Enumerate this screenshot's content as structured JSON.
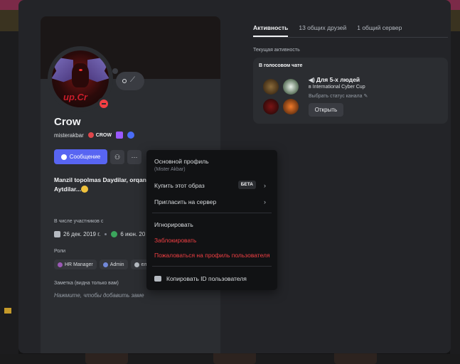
{
  "profile": {
    "display_name": "Crow",
    "username": "misterakbar",
    "avatar_text": "up.Cr",
    "clan_tag": "CROW",
    "bio": "Manzil topolmas Daydilar, orqang",
    "bio_line2": "Aytdilar...",
    "member_since_label": "В числе участников с",
    "discord_since": "26 дек. 2019 г.",
    "server_since": "6 июн. 20",
    "roles_label": "Роли",
    "roles": [
      {
        "name": "HR Manager",
        "color": "#9b59b6"
      },
      {
        "name": "Admin",
        "color": "#7289da"
      },
      {
        "name": "ел",
        "color": "#b5bac1"
      }
    ],
    "note_label": "Заметка (видна только вам)",
    "note_placeholder": "Нажмите, чтобы добавить заме"
  },
  "actions": {
    "message_label": "Сообщение",
    "more_label": "···",
    "friend_icon": "add-friend-icon"
  },
  "tabs": [
    {
      "label": "Активность",
      "active": true
    },
    {
      "label": "13 общих друзей",
      "active": false
    },
    {
      "label": "1 общий сервер",
      "active": false
    }
  ],
  "activity": {
    "section_label": "Текущая активность",
    "card_title": "В голосовом чате",
    "channel_name": "Для 5-х людей",
    "server_name": "в International Cyber Cup",
    "status_text": "Выбрать статус канала",
    "open_label": "Открыть"
  },
  "menu": {
    "main_profile": "Основной профиль",
    "main_profile_sub": "(Mister Akbar)",
    "buy_look": "Купить этот образ",
    "beta": "БЕТА",
    "invite": "Пригласить на сервер",
    "ignore": "Игнорировать",
    "block": "Заблокировать",
    "report": "Пожаловаться на профиль пользователя",
    "copy_id": "Копировать ID пользователя"
  },
  "window": {
    "close_label": "✕"
  },
  "colors": {
    "accent": "#5865f2",
    "danger": "#f23f43",
    "surface": "#2b2d31",
    "menu_bg": "#111214"
  }
}
